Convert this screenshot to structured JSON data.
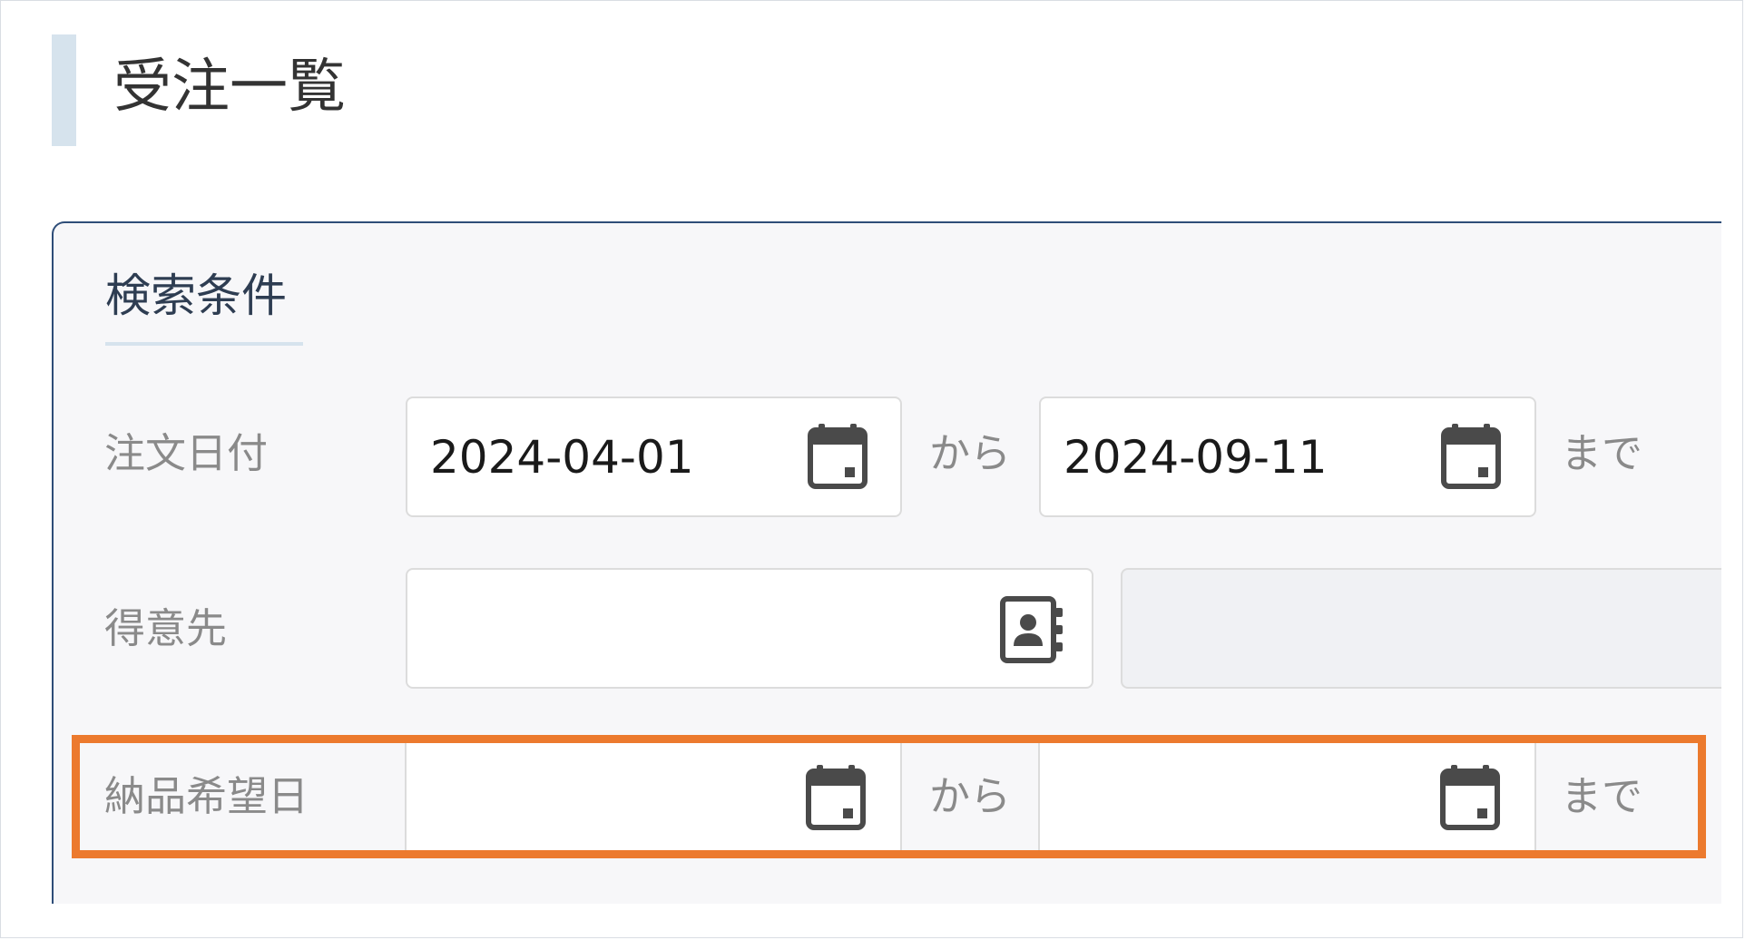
{
  "page": {
    "title": "受注一覧"
  },
  "search": {
    "title": "検索条件",
    "order_date": {
      "label": "注文日付",
      "from_value": "2024-04-01",
      "to_value": "2024-09-11",
      "from_sep": "から",
      "to_sep": "まで"
    },
    "customer": {
      "label": "得意先",
      "code_value": "",
      "name_value": ""
    },
    "delivery_date": {
      "label": "納品希望日",
      "from_value": "",
      "to_value": "",
      "from_sep": "から",
      "to_sep": "まで"
    }
  },
  "icons": {
    "calendar": "calendar-icon",
    "contact": "contact-book-icon"
  },
  "colors": {
    "accent_border": "#2e4d78",
    "highlight": "#ec7a2e",
    "header_bar": "#d6e3ed"
  }
}
